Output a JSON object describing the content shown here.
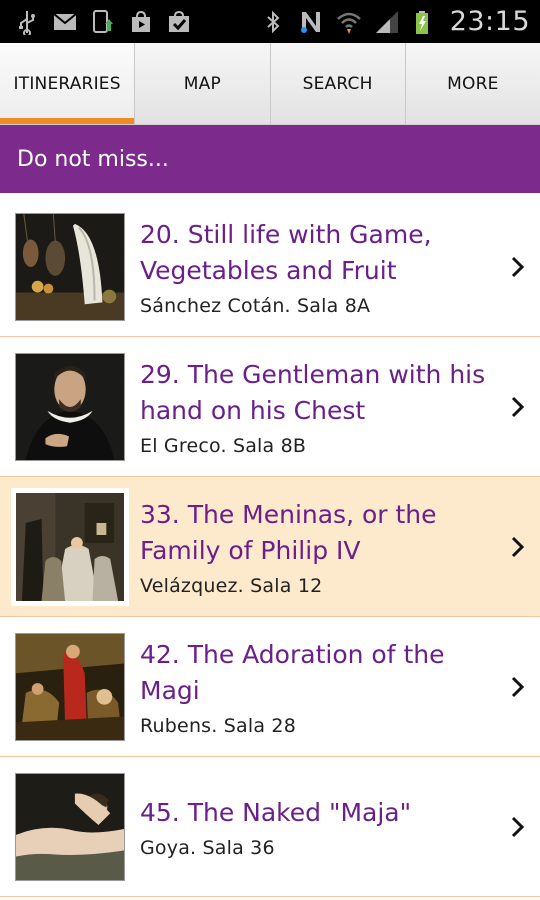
{
  "status_bar": {
    "time": "23:15",
    "left_icons": [
      "usb-icon",
      "gmail-icon",
      "phone-update-icon",
      "play-store-icon",
      "task-check-icon"
    ],
    "right_icons": [
      "bluetooth-icon",
      "nfc-icon",
      "wifi-icon",
      "signal-icon",
      "battery-charging-icon"
    ]
  },
  "tabs": [
    {
      "label": "ITINERARIES",
      "active": true
    },
    {
      "label": "MAP",
      "active": false
    },
    {
      "label": "SEARCH",
      "active": false
    },
    {
      "label": "MORE",
      "active": false
    }
  ],
  "section": {
    "title": "Do not miss..."
  },
  "colors": {
    "accent": "#f08a24",
    "header_purple": "#7c2a8c",
    "title_purple": "#6b1f8a",
    "highlight_row": "#fde9cc"
  },
  "items": [
    {
      "title": "20. Still life with Game, Vegetables and Fruit",
      "subtitle": "Sánchez Cotán. Sala 8A",
      "thumb": "still-life-thumbnail",
      "selected": false
    },
    {
      "title": "29. The Gentleman with his hand on his Chest",
      "subtitle": "El Greco. Sala 8B",
      "thumb": "gentleman-thumbnail",
      "selected": false
    },
    {
      "title": "33. The Meninas, or the Family of Philip IV",
      "subtitle": "Velázquez. Sala 12",
      "thumb": "meninas-thumbnail",
      "selected": true
    },
    {
      "title": "42. The Adoration of the Magi",
      "subtitle": "Rubens. Sala 28",
      "thumb": "adoration-thumbnail",
      "selected": false
    },
    {
      "title": "45. The Naked \"Maja\"",
      "subtitle": "Goya. Sala 36",
      "thumb": "maja-thumbnail",
      "selected": false
    }
  ]
}
